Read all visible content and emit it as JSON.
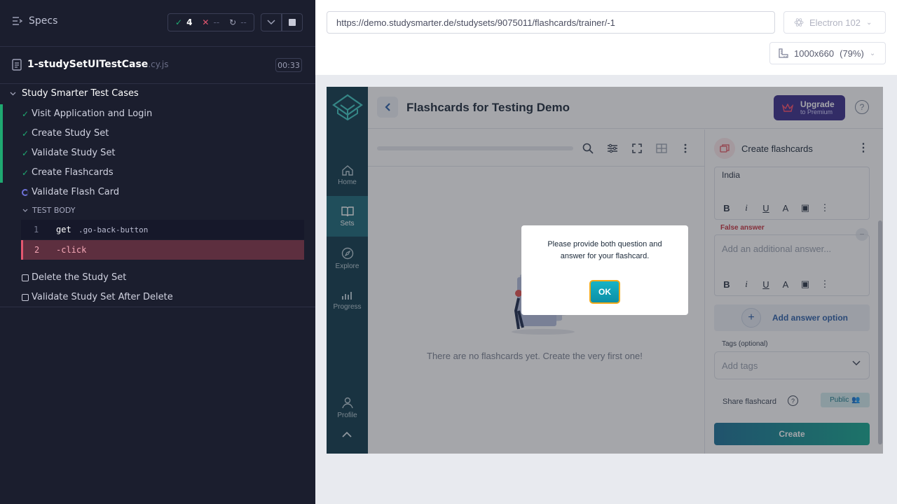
{
  "runner": {
    "header": {
      "title": "Specs"
    },
    "stats": {
      "passed": "4",
      "failed": "--",
      "pending": "--"
    },
    "spec": {
      "name": "1-studySetUITestCase",
      "ext": ".cy.js",
      "duration": "00:33"
    },
    "suite": {
      "title": "Study Smarter Test Cases"
    },
    "tests": [
      {
        "label": "Visit Application and Login",
        "state": "passed"
      },
      {
        "label": "Create Study Set",
        "state": "passed"
      },
      {
        "label": "Validate Study Set",
        "state": "passed"
      },
      {
        "label": "Create Flashcards",
        "state": "passed"
      },
      {
        "label": "Validate Flash Card",
        "state": "running"
      },
      {
        "label": "Delete the Study Set",
        "state": "pending"
      },
      {
        "label": "Validate Study Set After Delete",
        "state": "pending"
      }
    ],
    "test_body": {
      "title": "TEST BODY",
      "commands": [
        {
          "num": "1",
          "name": "get",
          "arg": ".go-back-button"
        },
        {
          "num": "2",
          "name": "-click",
          "arg": ""
        }
      ]
    }
  },
  "browser": {
    "url": "https://demo.studysmarter.de/studysets/9075011/flashcards/trainer/-1",
    "browser_name": "Electron 102",
    "viewport": "1000x660",
    "zoom": "(79%)"
  },
  "app": {
    "nav": [
      {
        "label": "Home",
        "icon": "home-icon"
      },
      {
        "label": "Sets",
        "icon": "book-icon",
        "active": true
      },
      {
        "label": "Explore",
        "icon": "compass-icon"
      },
      {
        "label": "Progress",
        "icon": "bars-icon"
      },
      {
        "label": "Profile",
        "icon": "person-icon"
      }
    ],
    "title": "Flashcards for Testing Demo",
    "upgrade": {
      "line1": "Upgrade",
      "line2": "to Premium"
    },
    "help": "?",
    "empty_text": "There are no flashcards yet. Create the very first one!",
    "create_panel": {
      "title": "Create flashcards",
      "answer_value": "India",
      "false_label": "False answer",
      "additional_placeholder": "Add an additional answer...",
      "add_answer_label": "Add answer option",
      "tags_label": "Tags (optional)",
      "tags_placeholder": "Add tags",
      "share_label": "Share flashcard",
      "public_label": "Public",
      "create_label": "Create"
    },
    "modal": {
      "message": "Please provide both question and answer for your flashcard.",
      "ok_label": "OK"
    }
  },
  "colors": {
    "runner_bg": "#1b1e2e",
    "pass": "#1fa971",
    "fail": "#e45770",
    "app_sidebar": "#0f3a4a",
    "accent": "#15a88f"
  }
}
